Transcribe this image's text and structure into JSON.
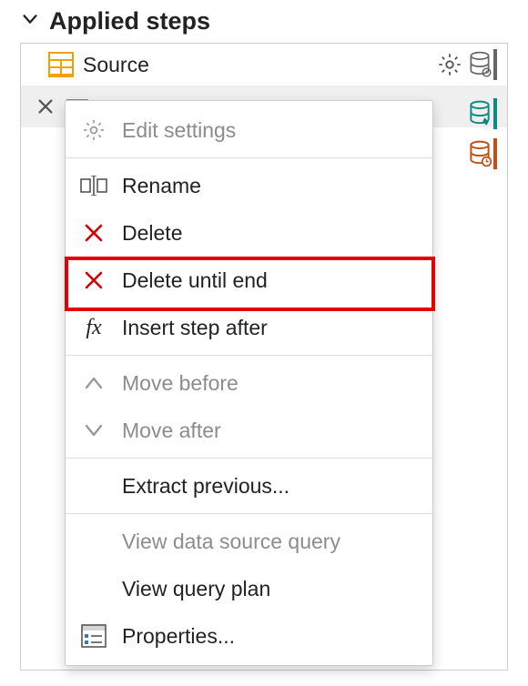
{
  "header": {
    "title": "Applied steps"
  },
  "steps": [
    {
      "name": "Source"
    }
  ],
  "context_menu": {
    "edit_settings": "Edit settings",
    "rename": "Rename",
    "delete": "Delete",
    "delete_until_end": "Delete until end",
    "insert_step_after": "Insert step after",
    "move_before": "Move before",
    "move_after": "Move after",
    "extract_previous": "Extract previous...",
    "view_data_source_query": "View data source query",
    "view_query_plan": "View query plan",
    "properties": "Properties..."
  }
}
